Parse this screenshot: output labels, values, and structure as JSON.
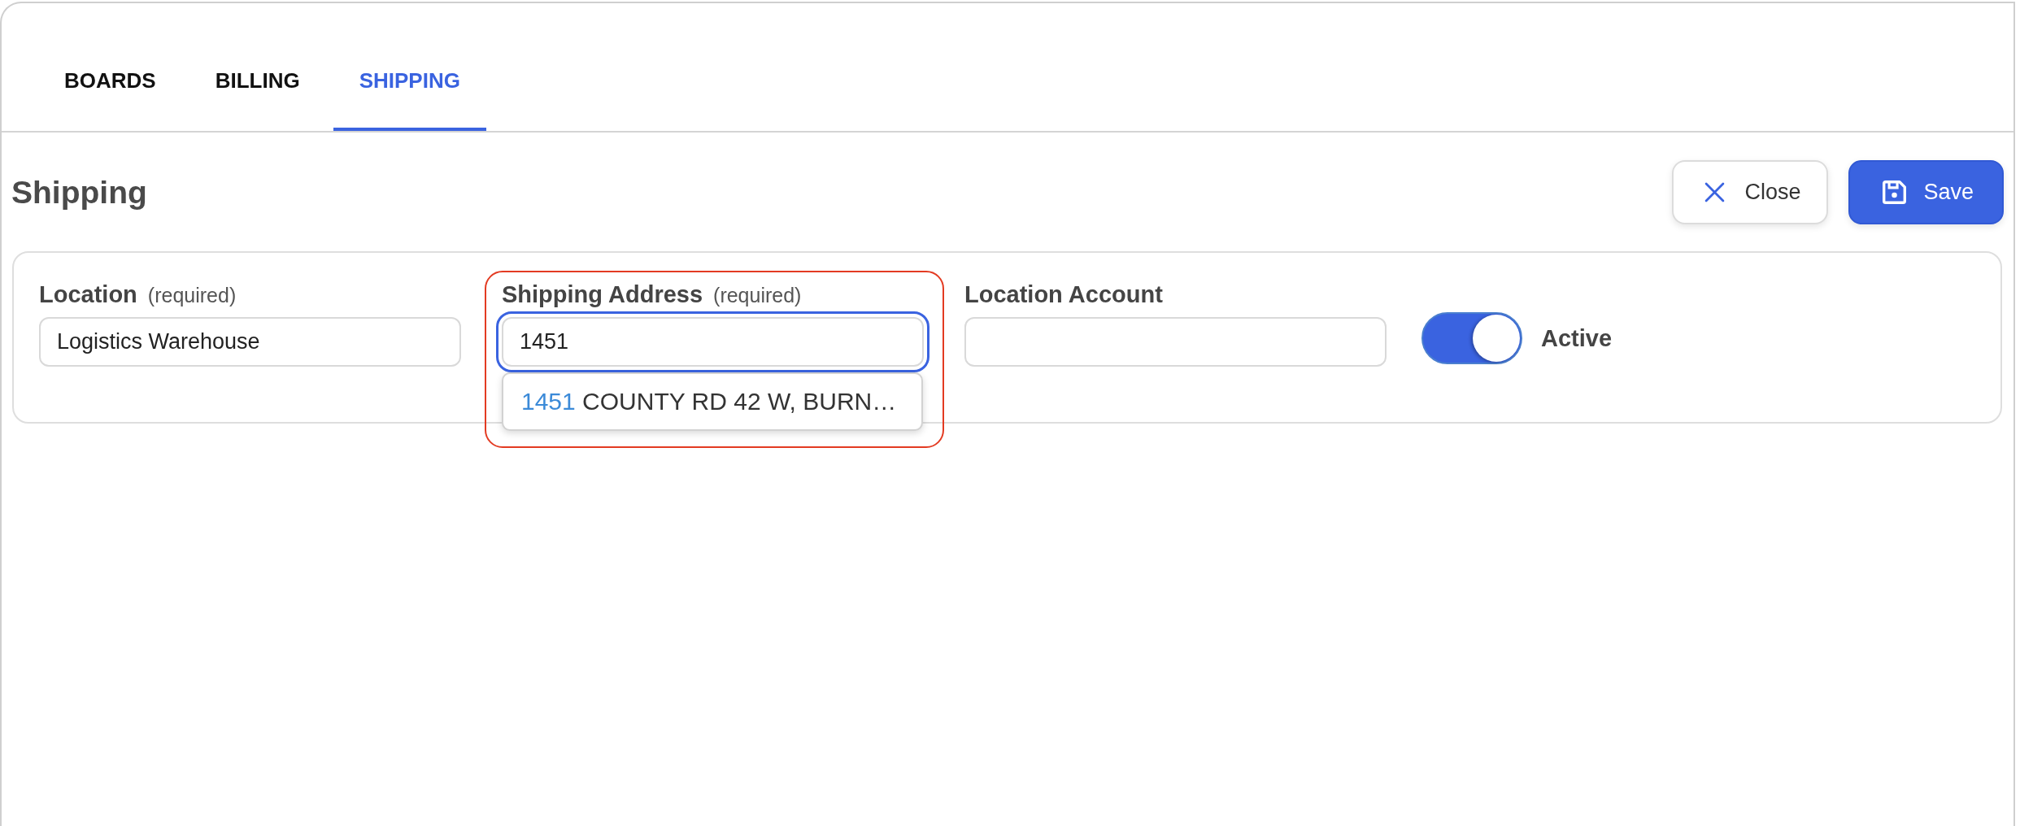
{
  "tabs": [
    {
      "label": "BOARDS",
      "selected": false
    },
    {
      "label": "BILLING",
      "selected": false
    },
    {
      "label": "SHIPPING",
      "selected": true
    }
  ],
  "header": {
    "title": "Shipping",
    "buttons": [
      {
        "kind": "close",
        "label": "Close"
      },
      {
        "kind": "save",
        "label": "Save"
      }
    ]
  },
  "form": {
    "fields": [
      {
        "kind": "text",
        "label": "Location",
        "note": "(required)",
        "value": "Logistics Warehouse",
        "focused": false,
        "marked": false
      },
      {
        "kind": "text",
        "label": "Shipping Address",
        "note": "(required)",
        "value": "1451",
        "focused": true,
        "marked": true,
        "suggestions": [
          {
            "match": "1451",
            "rest": "COUNTY RD 42 W, BURN…"
          }
        ]
      },
      {
        "kind": "text",
        "label": "Location Account",
        "focused": false,
        "marked": false
      },
      {
        "kind": "toggle",
        "label": "Active",
        "on": true
      }
    ]
  }
}
